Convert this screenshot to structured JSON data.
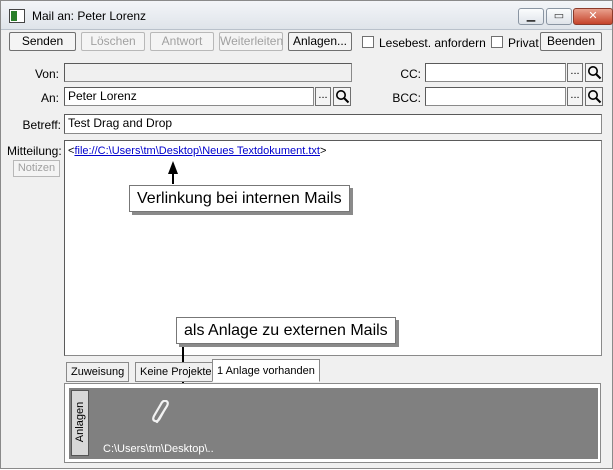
{
  "window": {
    "title": "Mail an: Peter Lorenz",
    "controls": {
      "minimize": "▁",
      "maximize": "▭",
      "close": "✕"
    }
  },
  "toolbar": {
    "send": "Senden",
    "delete": "Löschen",
    "reply": "Antwort",
    "forward": "Weiterleiten",
    "attachments": "Anlagen...",
    "read_receipt": "Lesebest. anfordern",
    "private": "Privat",
    "close": "Beenden"
  },
  "header": {
    "from_label": "Von:",
    "from_value": "",
    "to_label": "An:",
    "to_value": "Peter Lorenz",
    "cc_label": "CC:",
    "cc_value": "",
    "bcc_label": "BCC:",
    "bcc_value": "",
    "subject_label": "Betreff:",
    "subject_value": "Test Drag and Drop",
    "browse_label": "..."
  },
  "message": {
    "label": "Mitteilung:",
    "notes_button": "Notizen",
    "link_open": "<",
    "link_text": "file://C:\\Users\\tm\\Desktop\\Neues Textdokument.txt",
    "link_close": ">"
  },
  "annotations": {
    "internal": "Verlinkung bei internen Mails",
    "external": "als Anlage zu externen Mails"
  },
  "tabs": [
    {
      "label": "Zuweisung"
    },
    {
      "label": "Keine Projekte"
    },
    {
      "label": "1 Anlage vorhanden"
    }
  ],
  "attachments": {
    "side_tab": "Anlagen",
    "path": "C:\\Users\\tm\\Desktop\\.."
  }
}
